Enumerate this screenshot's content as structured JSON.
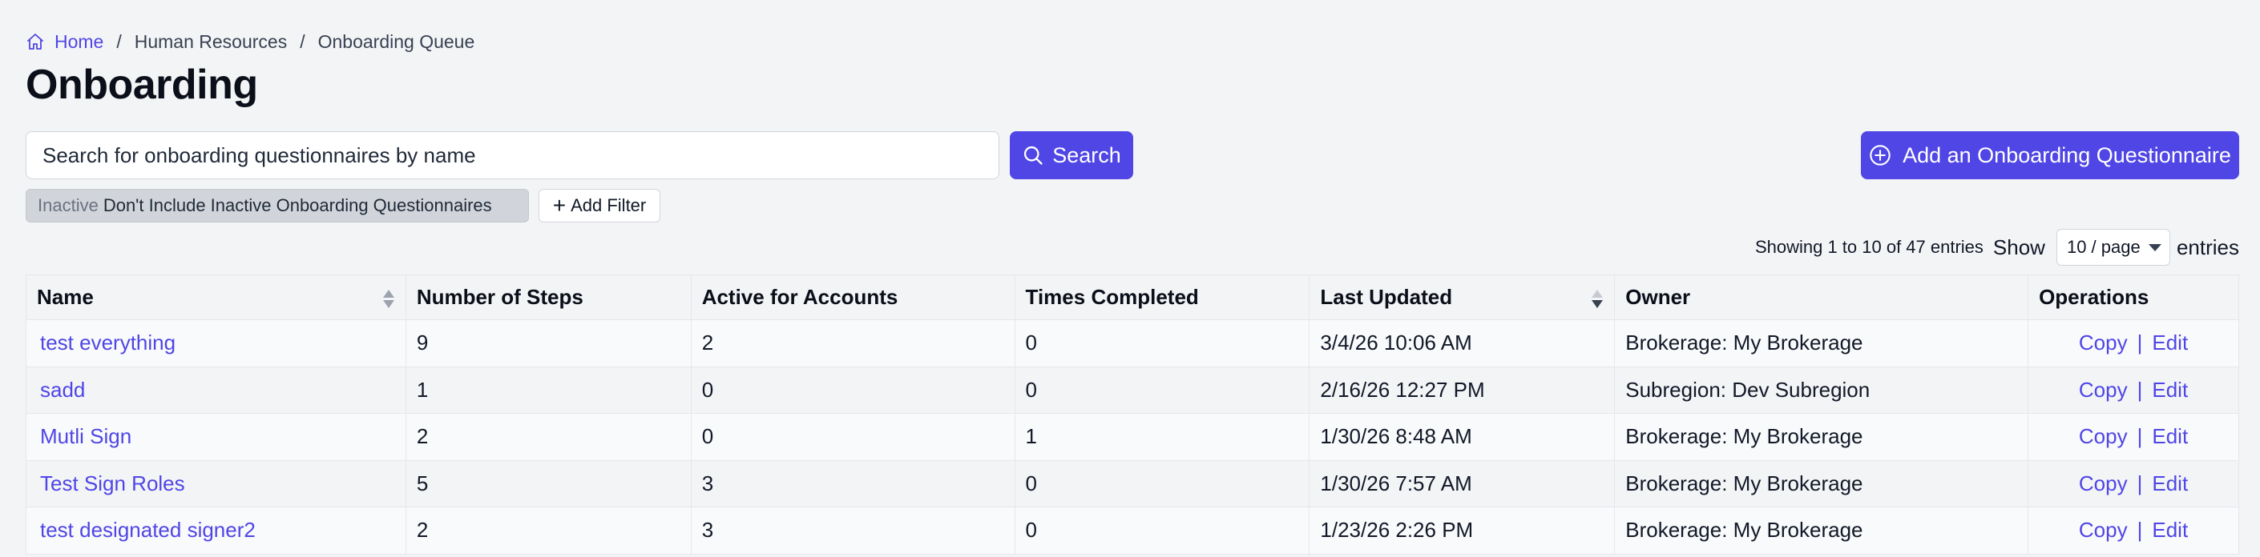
{
  "breadcrumb": {
    "home": "Home",
    "sep1": "/",
    "section": "Human Resources",
    "sep2": "/",
    "current": "Onboarding Queue"
  },
  "page_title": "Onboarding",
  "search": {
    "placeholder": "Search for onboarding questionnaires by name",
    "button_label": "Search"
  },
  "add_button_label": "Add an Onboarding Questionnaire",
  "filter": {
    "key": "Inactive",
    "value": "Don't Include Inactive Onboarding Questionnaires",
    "add_label": "Add Filter"
  },
  "pagination": {
    "summary": "Showing 1 to 10 of 47 entries",
    "show_label": "Show",
    "page_size": "10 / page",
    "entries_label": "entries"
  },
  "table": {
    "columns": {
      "name": "Name",
      "steps": "Number of Steps",
      "active": "Active for Accounts",
      "completed": "Times Completed",
      "updated": "Last Updated",
      "owner": "Owner",
      "operations": "Operations"
    },
    "copy_label": "Copy",
    "divider": "|",
    "edit_label": "Edit",
    "rows": [
      {
        "name": "test everything",
        "steps": "9",
        "active": "2",
        "completed": "0",
        "updated": "3/4/26 10:06 AM",
        "owner": "Brokerage: My Brokerage"
      },
      {
        "name": "sadd",
        "steps": "1",
        "active": "0",
        "completed": "0",
        "updated": "2/16/26 12:27 PM",
        "owner": "Subregion: Dev Subregion"
      },
      {
        "name": "Mutli Sign",
        "steps": "2",
        "active": "0",
        "completed": "1",
        "updated": "1/30/26 8:48 AM",
        "owner": "Brokerage: My Brokerage"
      },
      {
        "name": "Test Sign Roles",
        "steps": "5",
        "active": "3",
        "completed": "0",
        "updated": "1/30/26 7:57 AM",
        "owner": "Brokerage: My Brokerage"
      },
      {
        "name": "test designated signer2",
        "steps": "2",
        "active": "3",
        "completed": "0",
        "updated": "1/23/26 2:26 PM",
        "owner": "Brokerage: My Brokerage"
      }
    ]
  },
  "colors": {
    "accent": "#4f46e5",
    "background": "#f3f4f6",
    "chip": "#d1d5db"
  },
  "icons": [
    "home-icon",
    "search-icon",
    "plus-circle-icon",
    "plus-icon",
    "sort-icon",
    "caret-down-icon"
  ]
}
